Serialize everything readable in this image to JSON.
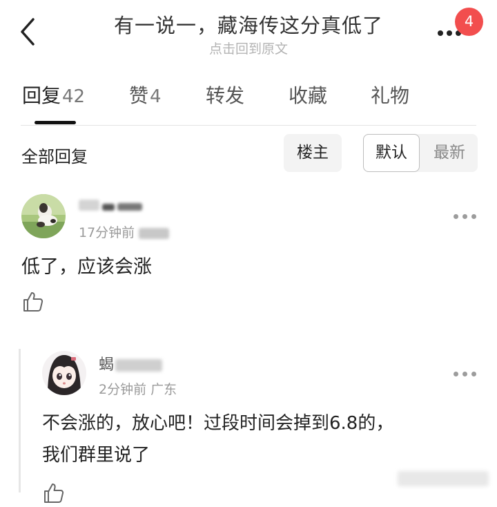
{
  "header": {
    "title": "有一说一，藏海传这分真低了",
    "subtitle": "点击回到原文",
    "badge_count": "4"
  },
  "tabs": [
    {
      "label": "回复",
      "count": "42",
      "active": true
    },
    {
      "label": "赞",
      "count": "4",
      "active": false
    },
    {
      "label": "转发",
      "count": "",
      "active": false
    },
    {
      "label": "收藏",
      "count": "",
      "active": false
    },
    {
      "label": "礼物",
      "count": "",
      "active": false
    }
  ],
  "filter": {
    "label": "全部回复",
    "owner_chip": "楼主",
    "sort_options": [
      "默认",
      "最新"
    ],
    "selected_sort": "默认"
  },
  "comments": [
    {
      "time": "17分钟前",
      "text": "低了，应该会涨"
    }
  ],
  "reply": {
    "name_visible": "蝎",
    "time": "2分钟前",
    "location": "广东",
    "text_line1": "不会涨的，放心吧！过段时间会掉到6.8的，",
    "text_line2": "我们群里说了"
  },
  "icons": {
    "back": "back-arrow-icon",
    "more": "more-dots-icon",
    "like": "thumbs-up-icon"
  },
  "colors": {
    "badge": "#f24e4e",
    "active_indicator": "#111111",
    "muted_text": "#9a9a9a"
  }
}
